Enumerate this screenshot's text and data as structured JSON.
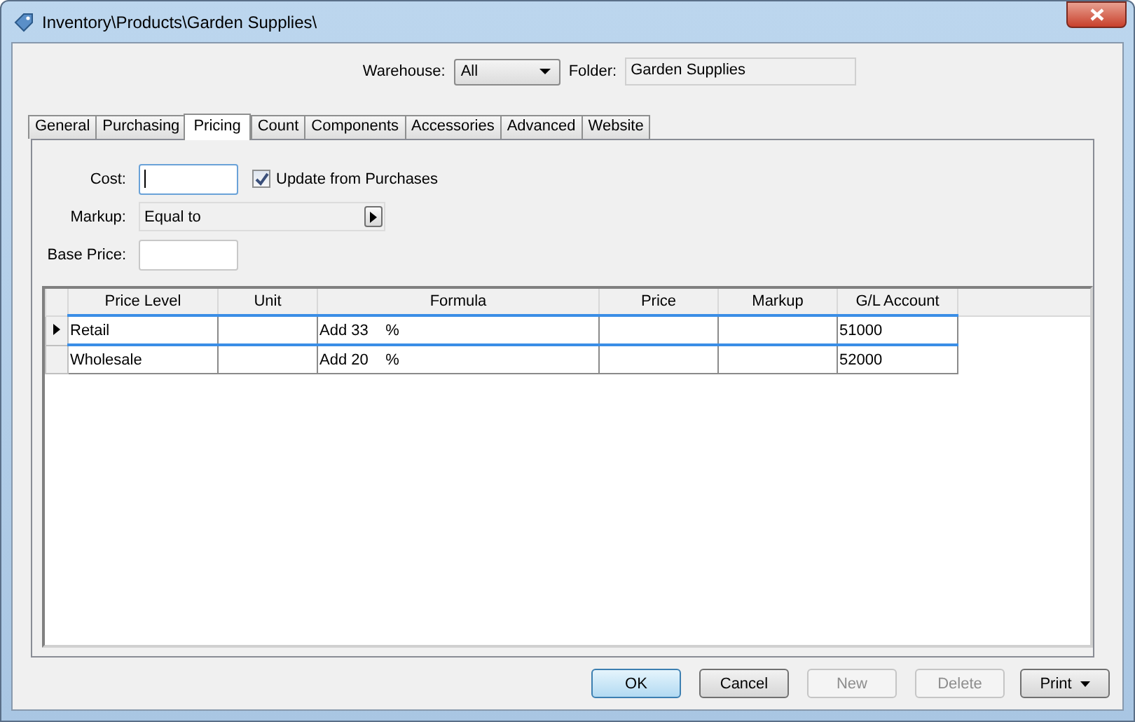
{
  "window": {
    "title": "Inventory\\Products\\Garden Supplies\\"
  },
  "header": {
    "warehouse_label": "Warehouse:",
    "warehouse_value": "All",
    "folder_label": "Folder:",
    "folder_value": "Garden Supplies"
  },
  "tabs": [
    {
      "label": "General",
      "selected": false
    },
    {
      "label": "Purchasing",
      "selected": false
    },
    {
      "label": "Pricing",
      "selected": true
    },
    {
      "label": "Count",
      "selected": false
    },
    {
      "label": "Components",
      "selected": false
    },
    {
      "label": "Accessories",
      "selected": false
    },
    {
      "label": "Advanced",
      "selected": false
    },
    {
      "label": "Website",
      "selected": false
    }
  ],
  "form": {
    "cost_label": "Cost:",
    "update_label": "Update from Purchases",
    "update_checked": true,
    "markup_label": "Markup:",
    "markup_value": "Equal to",
    "base_price_label": "Base Price:"
  },
  "table": {
    "columns": [
      "Price Level",
      "Unit",
      "Formula",
      "Price",
      "Markup",
      "G/L Account"
    ],
    "rows": [
      {
        "selected": true,
        "cells": [
          "Retail",
          "",
          "Add 33    %",
          "",
          "",
          "51000"
        ]
      },
      {
        "selected": false,
        "cells": [
          "Wholesale",
          "",
          "Add 20    %",
          "",
          "",
          "52000"
        ]
      }
    ]
  },
  "buttons": [
    {
      "label": "OK",
      "disabled": false,
      "kind": "default"
    },
    {
      "label": "Cancel",
      "disabled": false,
      "kind": "plain"
    },
    {
      "label": "New",
      "disabled": true,
      "kind": "plain"
    },
    {
      "label": "Delete",
      "disabled": true,
      "kind": "plain"
    },
    {
      "label": "Print",
      "disabled": false,
      "kind": "menu"
    }
  ]
}
